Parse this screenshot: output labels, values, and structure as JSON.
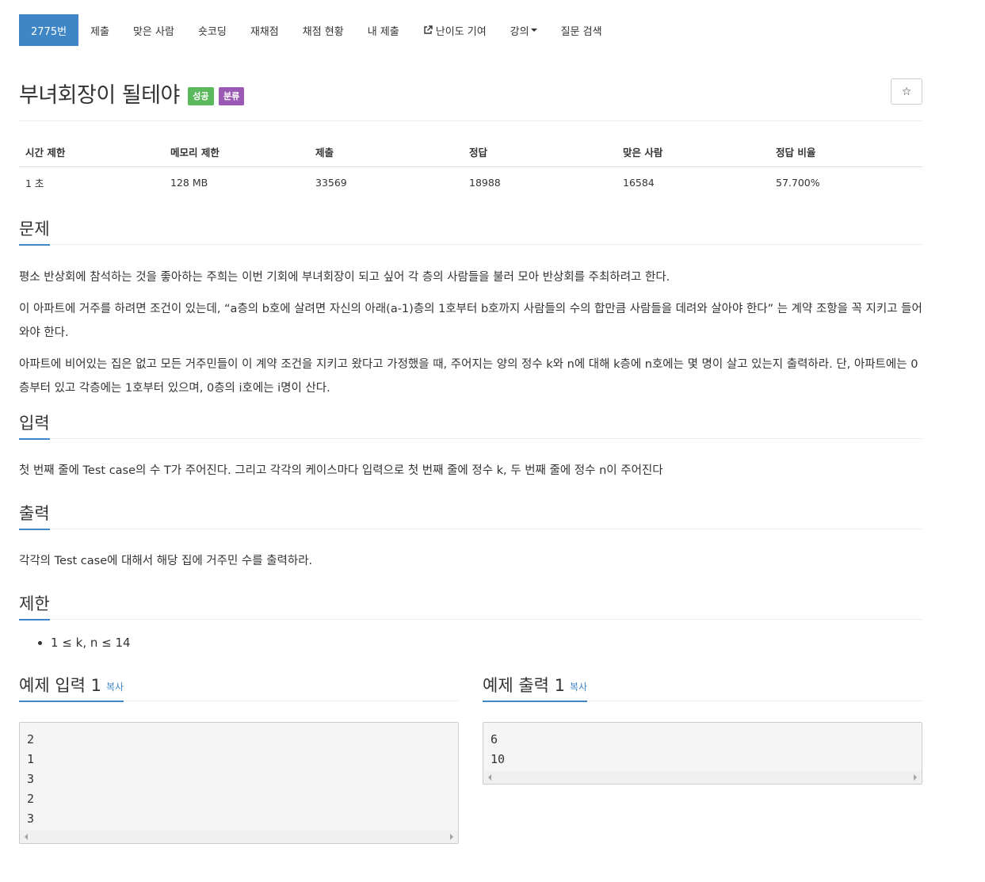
{
  "nav": {
    "items": [
      {
        "label": "2775번",
        "active": true
      },
      {
        "label": "제출"
      },
      {
        "label": "맞은 사람"
      },
      {
        "label": "숏코딩"
      },
      {
        "label": "재채점"
      },
      {
        "label": "채점 현황"
      },
      {
        "label": "내 제출"
      },
      {
        "label": "난이도 기여",
        "icon": "external-link-icon"
      },
      {
        "label": "강의",
        "icon": "caret-down-icon"
      },
      {
        "label": "질문 검색"
      }
    ]
  },
  "problem": {
    "title": "부녀회장이 될테야",
    "badge_success": "성공",
    "badge_category": "분류",
    "star_icon": "☆"
  },
  "info": {
    "headers": [
      "시간 제한",
      "메모리 제한",
      "제출",
      "정답",
      "맞은 사람",
      "정답 비율"
    ],
    "values": [
      "1 초",
      "128 MB",
      "33569",
      "18988",
      "16584",
      "57.700%"
    ]
  },
  "sections": {
    "problem_title": "문제",
    "problem_paragraphs": [
      "평소 반상회에 참석하는 것을 좋아하는 주희는 이번 기회에 부녀회장이 되고 싶어 각 층의 사람들을 불러 모아 반상회를 주최하려고 한다.",
      "이 아파트에 거주를 하려면 조건이 있는데, “a층의 b호에 살려면 자신의 아래(a-1)층의 1호부터 b호까지 사람들의 수의 합만큼 사람들을 데려와 살아야 한다” 는 계약 조항을 꼭 지키고 들어와야 한다.",
      "아파트에 비어있는 집은 없고 모든 거주민들이 이 계약 조건을 지키고 왔다고 가정했을 때, 주어지는 양의 정수 k와 n에 대해 k층에 n호에는 몇 명이 살고 있는지 출력하라. 단, 아파트에는 0층부터 있고 각층에는 1호부터 있으며, 0층의 i호에는 i명이 산다."
    ],
    "input_title": "입력",
    "input_text": "첫 번째 줄에 Test case의 수 T가 주어진다. 그리고 각각의 케이스마다 입력으로 첫 번째 줄에 정수 k, 두 번째 줄에 정수 n이 주어진다",
    "output_title": "출력",
    "output_text": "각각의 Test case에 대해서 해당 집에 거주민 수를 출력하라.",
    "limit_title": "제한",
    "limit_items": [
      "1 ≤ k, n ≤ 14"
    ]
  },
  "samples": {
    "input_title": "예제 입력 1",
    "output_title": "예제 출력 1",
    "copy_label": "복사",
    "input_text": "2\n1\n3\n2\n3",
    "output_text": "6\n10"
  }
}
